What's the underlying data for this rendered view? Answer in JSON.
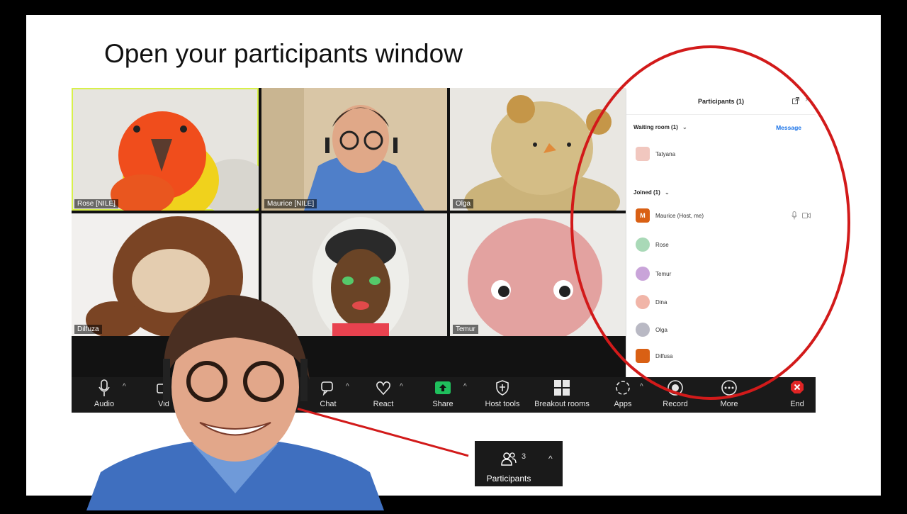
{
  "slide_title": "Open your participants window",
  "tiles": [
    {
      "label": "Rose [NILE]"
    },
    {
      "label": "Maurice [NILE]"
    },
    {
      "label": "Olga"
    },
    {
      "label": "Dilfuza"
    },
    {
      "label": ""
    },
    {
      "label": "Temur"
    }
  ],
  "toolbar": {
    "audio": "Audio",
    "video": "Vid",
    "chat": "Chat",
    "react": "React",
    "share": "Share",
    "host_tools": "Host tools",
    "breakout_rooms": "Breakout rooms",
    "apps": "Apps",
    "record": "Record",
    "more": "More",
    "end": "End"
  },
  "panel": {
    "title": "Participants (1)",
    "waiting_room": "Waiting room (1)",
    "message": "Message",
    "waiting": [
      {
        "name": "Tatyana"
      }
    ],
    "joined": "Joined (1)",
    "participants": [
      {
        "name": "Maurice (Host, me)",
        "initial": "M"
      },
      {
        "name": "Rose"
      },
      {
        "name": "Temur"
      },
      {
        "name": "Dina"
      },
      {
        "name": "Olga"
      },
      {
        "name": "Dilfusa"
      }
    ]
  },
  "participants_button": {
    "label": "Participants",
    "count": "3"
  },
  "colors": {
    "accent_red": "#d21a1a",
    "share_green": "#1fbf5c",
    "link_blue": "#1a73e8",
    "host_orange": "#d96014"
  }
}
